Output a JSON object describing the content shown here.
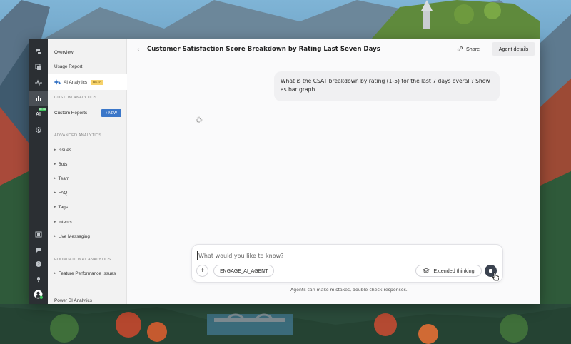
{
  "app": {
    "title": "Customer Satisfaction Score Breakdown by Rating Last Seven Days"
  },
  "rail": {
    "icons": [
      "chat-icon",
      "inbox-icon",
      "activity-icon",
      "analytics-icon",
      "ai-icon",
      "settings-icon",
      "calendar-icon",
      "messages-icon",
      "help-icon",
      "bell-icon",
      "avatar"
    ],
    "ai_badge": "BETA",
    "ai_label": "AI"
  },
  "sidebar": {
    "overview": "Overview",
    "usage_report": "Usage Report",
    "ai_analytics": "AI Analytics",
    "beta": "BETA",
    "custom_analytics_header": "CUSTOM ANALYTICS",
    "custom_reports": "Custom Reports",
    "new_button": "+ NEW",
    "advanced_header": "ADVANCED ANALYTICS",
    "advanced_items": [
      "Issues",
      "Bots",
      "Team",
      "FAQ",
      "Tags",
      "Intents",
      "Live Messaging"
    ],
    "foundational_header": "FOUNDATIONAL ANALYTICS",
    "foundational_items": [
      "Feature Performance Issues"
    ],
    "power_bi": "Power BI Analytics"
  },
  "header": {
    "share_label": "Share",
    "agent_details_label": "Agent details"
  },
  "conversation": {
    "user_message": "What is the CSAT breakdown by rating (1-5) for the last 7 days overall? Show as bar graph."
  },
  "composer": {
    "placeholder": "What would you like to know?",
    "value": "",
    "agent_chip": "ENGAGE_AI_AGENT",
    "extended_thinking": "Extended thinking"
  },
  "footer": {
    "disclaimer": "Agents can make mistakes, double-check responses."
  },
  "colors": {
    "rail_bg": "#2b2f33",
    "sidebar_bg": "#f2f2f2",
    "accent": "#3b77c9",
    "beta_badge": "#f6d26b",
    "online": "#3cc25a"
  }
}
